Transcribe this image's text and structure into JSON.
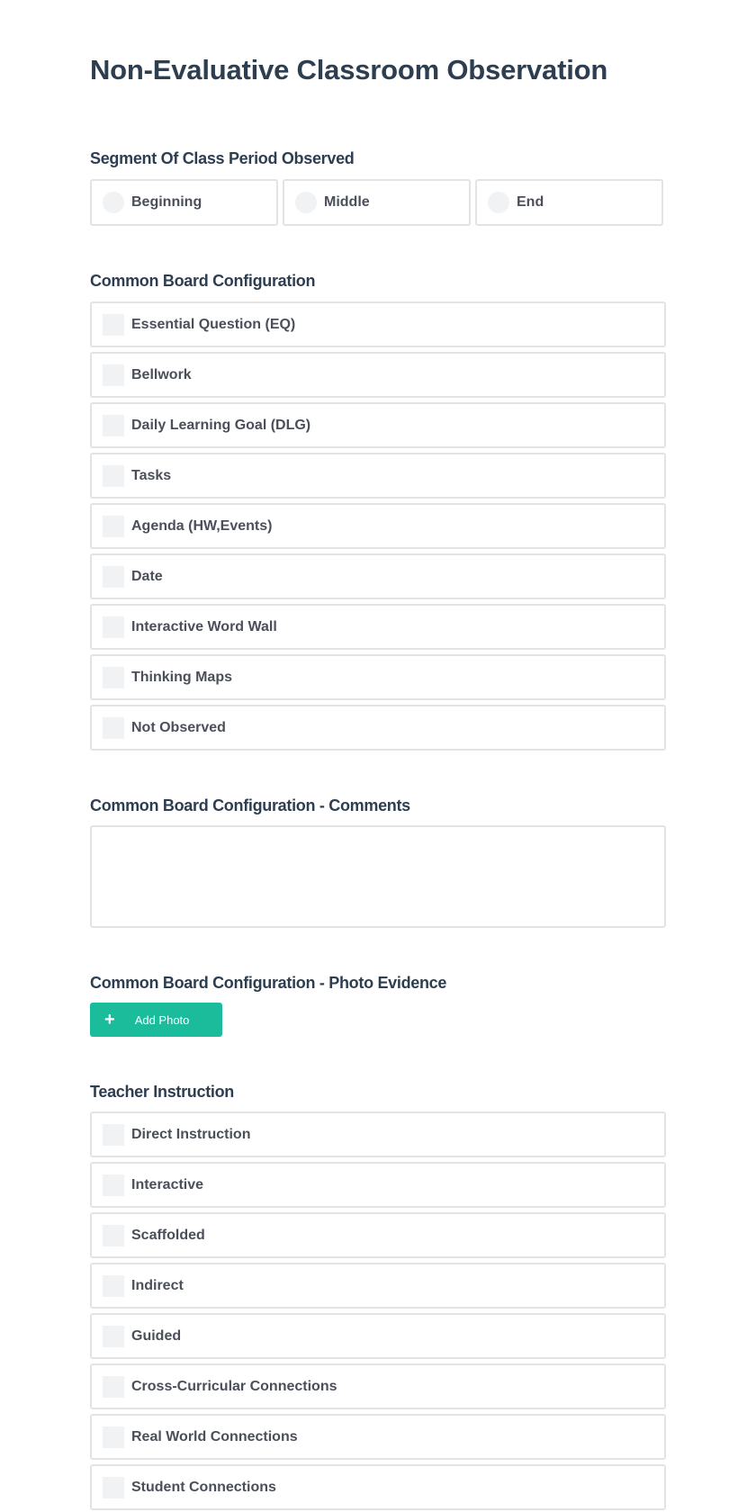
{
  "page": {
    "title": "Non-Evaluative Classroom Observation"
  },
  "segment": {
    "label": "Segment Of Class Period Observed",
    "options": [
      {
        "label": "Beginning"
      },
      {
        "label": "Middle"
      },
      {
        "label": "End"
      }
    ]
  },
  "board_config": {
    "label": "Common Board Configuration",
    "options": [
      {
        "label": "Essential Question (EQ)"
      },
      {
        "label": "Bellwork"
      },
      {
        "label": "Daily Learning Goal (DLG)"
      },
      {
        "label": "Tasks"
      },
      {
        "label": "Agenda (HW,Events)"
      },
      {
        "label": "Date"
      },
      {
        "label": "Interactive Word Wall"
      },
      {
        "label": "Thinking Maps"
      },
      {
        "label": "Not Observed"
      }
    ]
  },
  "board_comments": {
    "label": "Common Board Configuration - Comments",
    "value": ""
  },
  "board_photo": {
    "label": "Common Board Configuration - Photo Evidence",
    "button_label": "Add Photo",
    "button_icon": "plus-icon",
    "button_color": "#1abc9c"
  },
  "teacher_instruction": {
    "label": "Teacher Instruction",
    "options": [
      {
        "label": "Direct Instruction"
      },
      {
        "label": "Interactive"
      },
      {
        "label": "Scaffolded"
      },
      {
        "label": "Indirect"
      },
      {
        "label": "Guided"
      },
      {
        "label": "Cross-Curricular Connections"
      },
      {
        "label": "Real World Connections"
      },
      {
        "label": "Student Connections"
      }
    ]
  }
}
